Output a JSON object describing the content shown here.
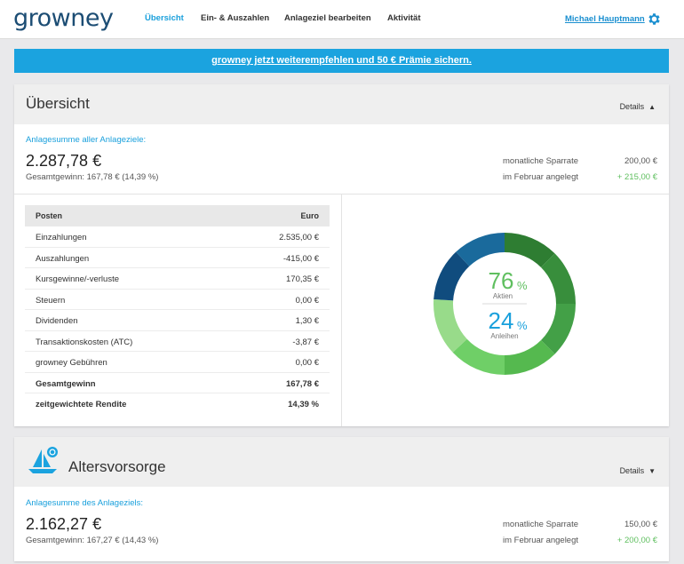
{
  "brand": {
    "logo_text": "growney",
    "accent": "#1aa0dc",
    "logo_color": "#1c4d74"
  },
  "nav": {
    "items": [
      {
        "label": "Übersicht",
        "active": true
      },
      {
        "label": "Ein- & Auszahlen",
        "active": false
      },
      {
        "label": "Anlageziel bearbeiten",
        "active": false
      },
      {
        "label": "Aktivität",
        "active": false
      }
    ],
    "user_name": "Michael Hauptmann",
    "settings_icon": "gear-icon"
  },
  "banner": {
    "text": "growney jetzt weiterempfehlen und 50 € Prämie sichern.",
    "color": "#1ba3df"
  },
  "overview": {
    "title": "Übersicht",
    "details_label": "Details",
    "details_icon": "chevron-up-icon",
    "sum_label": "Anlagesumme aller Anlageziele:",
    "sum_value": "2.287,78 €",
    "total_gain": "Gesamtgewinn: 167,78 € (14,39 %)",
    "monthly_label": "monatliche Sparrate",
    "monthly_value": "200,00 €",
    "month_label": "im Februar angelegt",
    "month_value": "+ 215,00 €",
    "table": {
      "headers": [
        "Posten",
        "Euro"
      ],
      "rows": [
        {
          "label": "Einzahlungen",
          "value": "2.535,00 €",
          "bold": false
        },
        {
          "label": "Auszahlungen",
          "value": "-415,00 €",
          "bold": false
        },
        {
          "label": "Kursgewinne/-verluste",
          "value": "170,35 €",
          "bold": false
        },
        {
          "label": "Steuern",
          "value": "0,00 €",
          "bold": false
        },
        {
          "label": "Dividenden",
          "value": "1,30 €",
          "bold": false
        },
        {
          "label": "Transaktionskosten (ATC)",
          "value": "-3,87 €",
          "bold": false
        },
        {
          "label": "growney Gebühren",
          "value": "0,00 €",
          "bold": false
        },
        {
          "label": "Gesamtgewinn",
          "value": "167,78 €",
          "bold": true
        },
        {
          "label": "zeitgewichtete Rendite",
          "value": "14,39 %",
          "bold": true
        }
      ]
    },
    "allocation": {
      "stocks_pct": 76,
      "stocks_label": "Aktien",
      "bonds_pct": 24,
      "bonds_label": "Anleihen",
      "percent_sign": "%",
      "stocks_color": "#5fbf5f",
      "bonds_color": "#1aa0dc",
      "segments": [
        {
          "share": 0.125,
          "color": "#2e7d32"
        },
        {
          "share": 0.125,
          "color": "#388e3c"
        },
        {
          "share": 0.125,
          "color": "#43a047"
        },
        {
          "share": 0.125,
          "color": "#55b94f"
        },
        {
          "share": 0.13,
          "color": "#6fcf67"
        },
        {
          "share": 0.13,
          "color": "#98db8a"
        },
        {
          "share": 0.12,
          "color": "#104c7e"
        },
        {
          "share": 0.12,
          "color": "#1a6a9c"
        }
      ]
    }
  },
  "goal": {
    "title": "Altersvorsorge",
    "icon": "sailboat-icon",
    "details_label": "Details",
    "details_icon": "chevron-down-icon",
    "sum_label": "Anlagesumme des Anlageziels:",
    "sum_value": "2.162,27 €",
    "total_gain": "Gesamtgewinn: 167,27 € (14,43 %)",
    "monthly_label": "monatliche Sparrate",
    "monthly_value": "150,00 €",
    "month_label": "im Februar angelegt",
    "month_value": "+ 200,00 €"
  }
}
